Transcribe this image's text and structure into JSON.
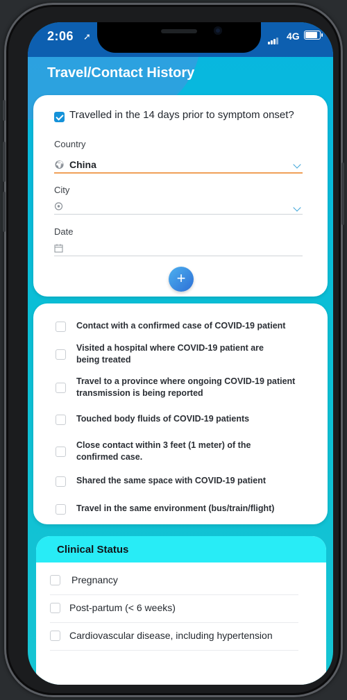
{
  "status_bar": {
    "time": "2:06",
    "network": "4G"
  },
  "header": {
    "title": "Travel/Contact History"
  },
  "travel": {
    "question": "Travelled in the 14 days prior to symptom onset?",
    "checked": true,
    "country": {
      "label": "Country",
      "value": "China"
    },
    "city": {
      "label": "City",
      "value": ""
    },
    "date": {
      "label": "Date",
      "value": ""
    },
    "add_label": "+"
  },
  "exposures": [
    {
      "text": "Contact with a confirmed case of COVID-19 patient",
      "checked": false
    },
    {
      "text": "Visited a hospital where COVID-19 patient are being treated",
      "checked": false
    },
    {
      "text": "Travel to a province where ongoing COVID-19 patient transmission is being reported",
      "checked": false
    },
    {
      "text": "Touched body fluids of COVID-19 patients",
      "checked": false
    },
    {
      "text": "Close contact within 3 feet (1 meter) of the confirmed case.",
      "checked": false
    },
    {
      "text": "Shared the same space with  COVID-19 patient",
      "checked": false
    },
    {
      "text": "Travel in the same environment (bus/train/flight)",
      "checked": false
    }
  ],
  "clinical": {
    "title": "Clinical Status",
    "items": [
      {
        "text": "Pregnancy",
        "checked": false
      },
      {
        "text": "Post-partum (< 6 weeks)",
        "checked": false
      },
      {
        "text": "Cardiovascular disease, including hypertension",
        "checked": false
      }
    ]
  },
  "colors": {
    "accent": "#1592d9",
    "header_band": "#28ecf6",
    "background": "#0bbfd6"
  },
  "icons": {
    "country": "globe-icon",
    "city": "location-pin-icon",
    "date": "calendar-icon",
    "dropdown": "chevron-down-icon",
    "add": "plus-icon"
  }
}
